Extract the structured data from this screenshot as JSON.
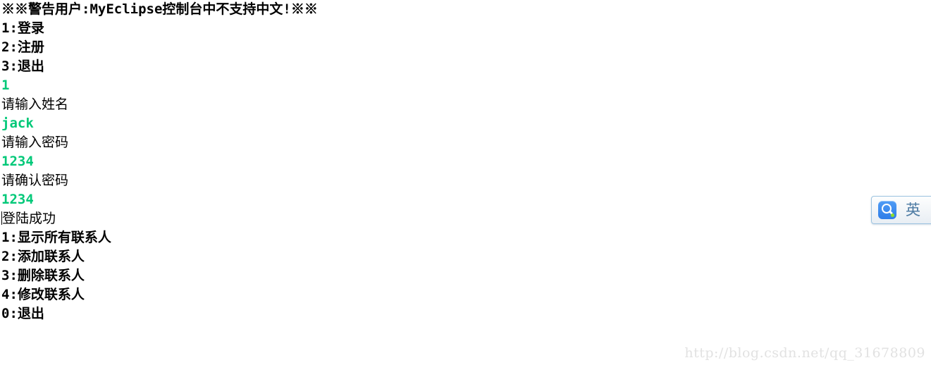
{
  "console": {
    "lines": [
      {
        "text": "※※警告用户:MyEclipse控制台中不支持中文!※※",
        "style": "bold",
        "kind": "warning-banner"
      },
      {
        "text": "1:登录",
        "style": "bold",
        "kind": "menu-option"
      },
      {
        "text": "2:注册",
        "style": "bold",
        "kind": "menu-option"
      },
      {
        "text": "3:退出",
        "style": "bold",
        "kind": "menu-option"
      },
      {
        "text": "1",
        "style": "input-echo",
        "kind": "user-input"
      },
      {
        "text": "请输入姓名",
        "style": "plain",
        "kind": "prompt"
      },
      {
        "text": "jack",
        "style": "input-echo",
        "kind": "user-input"
      },
      {
        "text": "请输入密码",
        "style": "plain",
        "kind": "prompt"
      },
      {
        "text": "1234",
        "style": "input-echo",
        "kind": "user-input"
      },
      {
        "text": "请确认密码",
        "style": "plain",
        "kind": "prompt"
      },
      {
        "text": "1234",
        "style": "input-echo",
        "kind": "user-input"
      },
      {
        "text": "登陆成功",
        "style": "plain",
        "kind": "status",
        "caret": true
      },
      {
        "text": "1:显示所有联系人",
        "style": "bold",
        "kind": "menu-option"
      },
      {
        "text": "2:添加联系人",
        "style": "bold",
        "kind": "menu-option"
      },
      {
        "text": "3:删除联系人",
        "style": "bold",
        "kind": "menu-option"
      },
      {
        "text": "4:修改联系人",
        "style": "bold",
        "kind": "menu-option"
      },
      {
        "text": "0:退出",
        "style": "bold",
        "kind": "menu-option"
      }
    ],
    "colors": {
      "text": "#000000",
      "input_echo": "#00c878",
      "background": "#ffffff"
    }
  },
  "ime_bar": {
    "logo_label": "Q",
    "mode_label": "英",
    "colors": {
      "logo_background": "#2f7de8",
      "status_dot": "#8ede2a",
      "border": "#9cc3e0",
      "mode_text": "#537fa6"
    }
  },
  "watermark": {
    "text": "http://blog.csdn.net/qq_31678809",
    "color": "#e2e2e2"
  }
}
